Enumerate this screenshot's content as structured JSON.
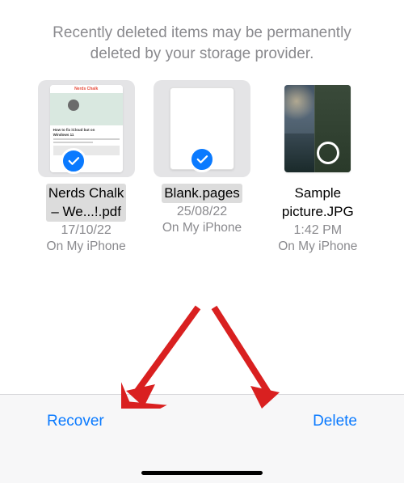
{
  "header": {
    "message": "Recently deleted items may be permanently deleted by your storage provider."
  },
  "items": [
    {
      "name_line1": "Nerds Chalk",
      "name_line2": "– We...!.pdf",
      "date": "17/10/22",
      "location": "On My iPhone",
      "selected": true
    },
    {
      "name_line1": "Blank.pages",
      "name_line2": "",
      "date": "25/08/22",
      "location": "On My iPhone",
      "selected": true
    },
    {
      "name_line1": "Sample",
      "name_line2": "picture.JPG",
      "date": "1:42 PM",
      "location": "On My iPhone",
      "selected": false
    }
  ],
  "actions": {
    "recover": "Recover",
    "delete": "Delete"
  },
  "colors": {
    "accent": "#0a7aff",
    "arrow": "#d92020"
  }
}
